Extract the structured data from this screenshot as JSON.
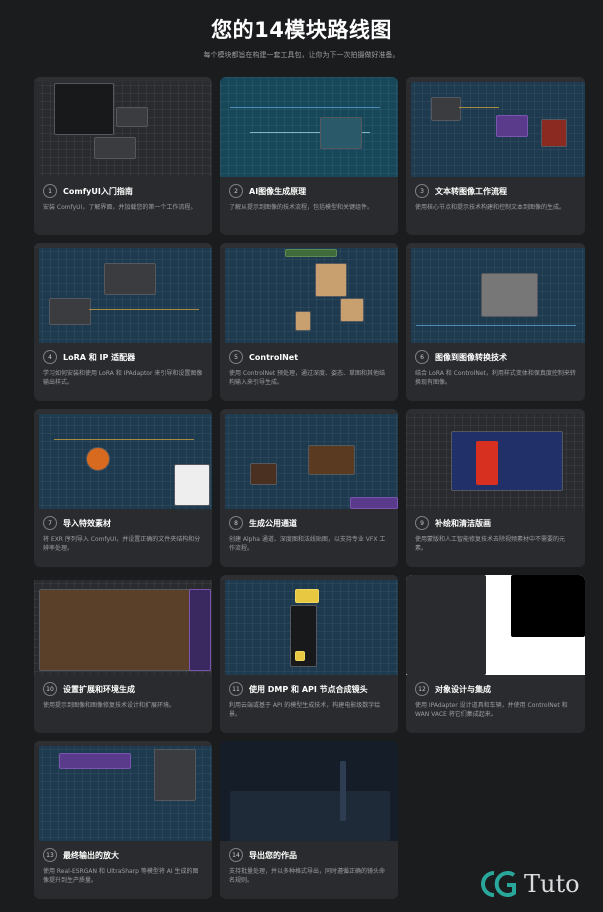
{
  "header": {
    "title": "您的14模块路线图",
    "subtitle": "每个模块都旨在构建一套工具包，让你为下一次拍摄做好准备。"
  },
  "modules": [
    {
      "num": "1",
      "label": "ComfyUI入门指南",
      "desc": "安装 ComfyUI，了解界面，并加载您的第一个工作流程。"
    },
    {
      "num": "2",
      "label": "AI图像生成原理",
      "desc": "了解从提示到图像的技术流程，包括模型和关键组件。"
    },
    {
      "num": "3",
      "label": "文本转图像工作流程",
      "desc": "使用核心节点和提示技术构建和控制文本到图像的生成。"
    },
    {
      "num": "4",
      "label": "LoRA 和 IP 适配器",
      "desc": "学习如何安装和使用 LoRA 和 IPAdaptor 来引导和设置图像输出样式。"
    },
    {
      "num": "5",
      "label": "ControlNet",
      "desc": "使用 ControlNet 预处理，通过深度、姿态、草图和其他结构输入来引导生成。"
    },
    {
      "num": "6",
      "label": "图像到图像转换技术",
      "desc": "结合 LoRA 和 ControlNet，利用样式变体和保真度控制来转换现有图像。"
    },
    {
      "num": "7",
      "label": "导入特效素材",
      "desc": "将 EXR 序列导入 ComfyUI，并设置正确的文件夹结构和分辨率处理。"
    },
    {
      "num": "8",
      "label": "生成公用通道",
      "desc": "创建 Alpha 通道、深度图和法线贴图，以支持专业 VFX 工作流程。"
    },
    {
      "num": "9",
      "label": "补绘和清洁版画",
      "desc": "使用蒙版和人工智能修复技术去除视频素材中不需要的元素。"
    },
    {
      "num": "10",
      "label": "设置扩展和环境生成",
      "desc": "使用提示到图像和图像修复技术设计和扩展环境。"
    },
    {
      "num": "11",
      "label": "使用 DMP 和 API 节点合成镜头",
      "desc": "利用云端或基于 API 的模型生成技术，构建电影级数字绘景。"
    },
    {
      "num": "12",
      "label": "对象设计与集成",
      "desc": "使用 IPAdapter 设计道具和车辆，并使用 ControlNet 和 WAN VACE 将它们集成起来。"
    },
    {
      "num": "13",
      "label": "最终输出的放大",
      "desc": "使用 Real-ESRGAN 和 UltraSharp 等模型将 AI 生成的图像提升到生产质量。"
    },
    {
      "num": "14",
      "label": "导出您的作品",
      "desc": "支持批量处理，并以多种格式导出，同时遵循正确的镜头命名规则。"
    }
  ],
  "logo": {
    "text": "Tuto",
    "colors": {
      "teal": "#2aa79b",
      "gray": "#d9dde0"
    }
  },
  "colors": {
    "background": "#1b1c1e",
    "card": "#2a2b2e",
    "thumb_blue": "#1e3a4f"
  }
}
